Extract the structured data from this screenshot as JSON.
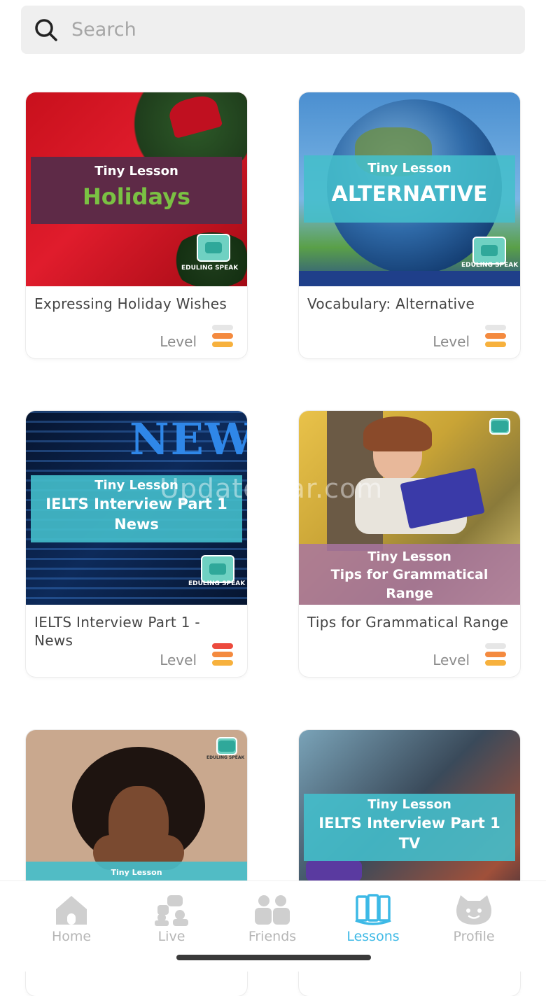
{
  "search": {
    "placeholder": "Search"
  },
  "cards": [
    {
      "banner_small": "Tiny Lesson",
      "banner_big": "Holidays",
      "logo_text": "EDULING SPEAK",
      "title": "Expressing Holiday Wishes",
      "level_label": "Level",
      "level_bars": [
        "#e6e6e6",
        "#f48a3f",
        "#f7b13d"
      ]
    },
    {
      "banner_small": "Tiny Lesson",
      "banner_big": "ALTERNATIVE",
      "logo_text": "EDULING SPEAK",
      "title": "Vocabulary: Alternative",
      "level_label": "Level",
      "level_bars": [
        "#e6e6e6",
        "#f48a3f",
        "#f7b13d"
      ]
    },
    {
      "banner_small": "Tiny Lesson",
      "banner_big": "IELTS Interview Part 1 News",
      "logo_text": "EDULING SPEAK",
      "title": "IELTS Interview Part 1 - News",
      "level_label": "Level",
      "level_bars": [
        "#ec4a3d",
        "#f48a3f",
        "#f7b13d"
      ]
    },
    {
      "banner_small": "Tiny Lesson",
      "banner_big": "Tips for Grammatical Range",
      "title": "Tips for Grammatical Range",
      "level_label": "Level",
      "level_bars": [
        "#e6e6e6",
        "#f48a3f",
        "#f7b13d"
      ]
    },
    {
      "banner_small": "Tiny Lesson",
      "logo_text": "EDULING SPEAK"
    },
    {
      "banner_small": "Tiny Lesson",
      "banner_big": "IELTS Interview Part 1 TV"
    }
  ],
  "watermark": "UpdateStar.com",
  "nav": {
    "items": [
      {
        "label": "Home",
        "icon": "home-icon"
      },
      {
        "label": "Live",
        "icon": "live-icon"
      },
      {
        "label": "Friends",
        "icon": "friends-icon"
      },
      {
        "label": "Lessons",
        "icon": "lessons-icon",
        "active": true
      },
      {
        "label": "Profile",
        "icon": "profile-icon"
      }
    ],
    "active_color": "#3db9e6",
    "inactive_color": "#cfcfcf"
  }
}
